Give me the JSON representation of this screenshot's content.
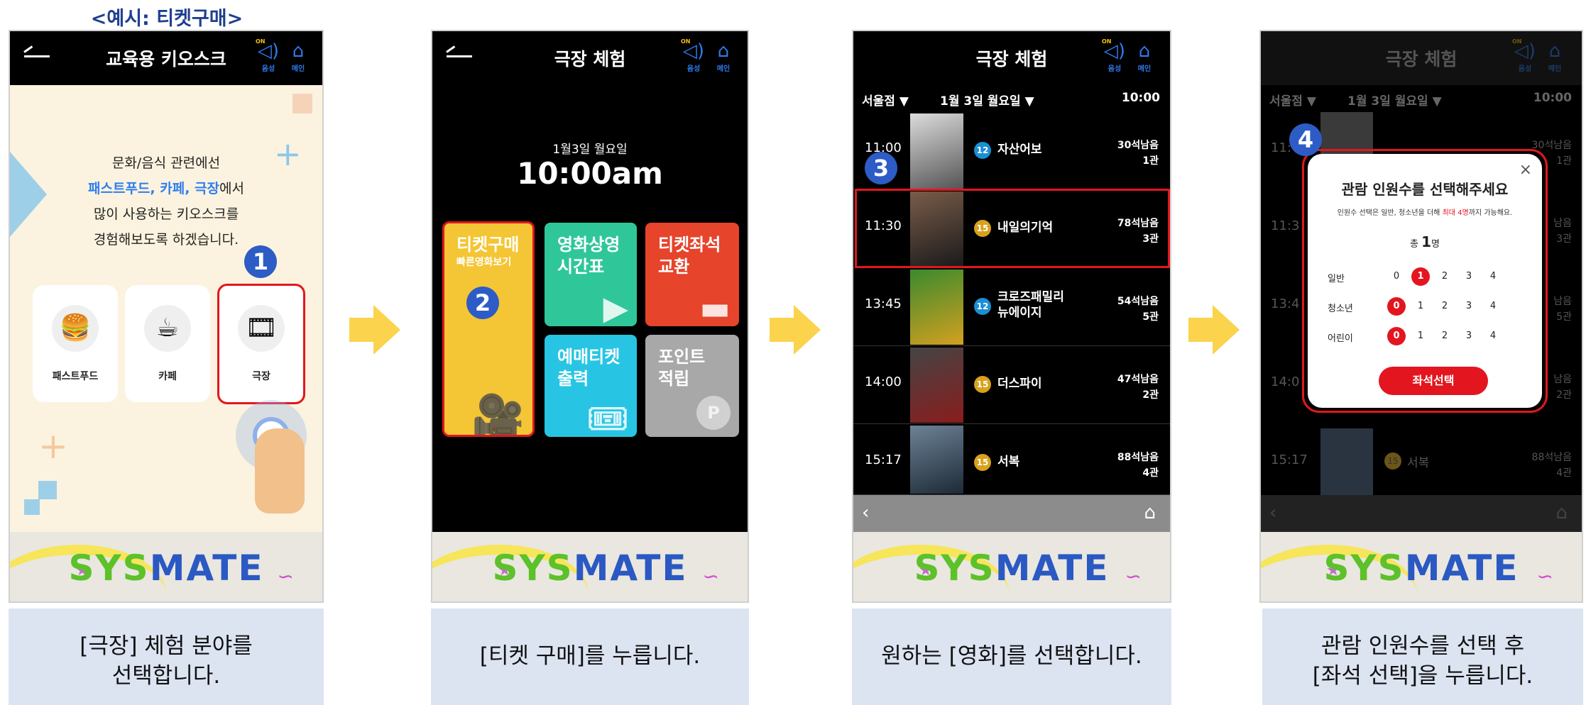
{
  "example_label": "<예시: 티켓구매>",
  "screen1": {
    "title": "교육용 키오스크",
    "sound_label": "음성",
    "sound_on": "ON",
    "main_label": "메인",
    "intro_line1": "문화/음식 관련에선",
    "intro_hl": "패스트푸드, 카페, 극장",
    "intro_line2_rest": "에서",
    "intro_line3": "많이 사용하는 키오스크를",
    "intro_line4": "경험해보도록 하겠습니다.",
    "step": "1",
    "cards": [
      "패스트푸드",
      "카페",
      "극장"
    ],
    "caption_line1": "[극장] 체험 분야를",
    "caption_line2": "선택합니다."
  },
  "screen2": {
    "title": "극장 체험",
    "sound_label": "음성",
    "sound_on": "ON",
    "main_label": "메인",
    "date": "1월3일 월요일",
    "time": "10:00am",
    "step": "2",
    "tiles": {
      "ticket_title": "티켓구매",
      "ticket_sub": "빠른영화보기",
      "schedule_line1": "영화상영",
      "schedule_line2": "시간표",
      "exchange_line1": "티켓좌석",
      "exchange_line2": "교환",
      "print_line1": "예매티켓",
      "print_line2": "출력",
      "point_line1": "포인트",
      "point_line2": "적립"
    },
    "caption": "[티켓 구매]를 누릅니다."
  },
  "screen3": {
    "title": "극장 체험",
    "sound_label": "음성",
    "sound_on": "ON",
    "main_label": "메인",
    "branch": "서울점 ▼",
    "date": "1월 3일 월요일 ▼",
    "time": "10:00",
    "step": "3",
    "movies": [
      {
        "time": "11:00",
        "age": "12",
        "name": "자산어보",
        "seats": "30석남음",
        "hall": "1관"
      },
      {
        "time": "11:30",
        "age": "15",
        "name": "내일의기억",
        "seats": "78석남음",
        "hall": "3관"
      },
      {
        "time": "13:45",
        "age": "12",
        "name": "크로즈패밀리",
        "name2": "뉴에이지",
        "seats": "54석남음",
        "hall": "5관"
      },
      {
        "time": "14:00",
        "age": "15",
        "name": "더스파이",
        "seats": "47석남음",
        "hall": "2관"
      },
      {
        "time": "15:17",
        "age": "15",
        "name": "서복",
        "seats": "88석남음",
        "hall": "4관"
      }
    ],
    "caption": "원하는 [영화]를 선택합니다."
  },
  "screen4": {
    "title": "극장 체험",
    "sound_label": "음성",
    "sound_on": "ON",
    "main_label": "메인",
    "branch": "서울점 ▼",
    "date": "1월 3일 월요일 ▼",
    "time": "10:00",
    "step": "4",
    "bg_times": [
      "11:",
      "11:3",
      "13:4",
      "14:0",
      "15:17"
    ],
    "bg_seats": [
      "30석남음",
      "남음",
      "남음",
      "남음",
      "88석남음"
    ],
    "bg_halls": [
      "1관",
      "3관",
      "5관",
      "2관",
      "4관"
    ],
    "bg_name": "서복",
    "bg_age": "15",
    "modal": {
      "title": "관람 인원수를 선택해주세요",
      "sub_pre": "인원수 선택은 일반, 청소년을 더해",
      "sub_red": "최대 4명",
      "sub_post": "까지 가능해요.",
      "total_pre": "총",
      "total_num": "1",
      "total_unit": "명",
      "rows": [
        {
          "label": "일반",
          "options": [
            "0",
            "1",
            "2",
            "3",
            "4"
          ],
          "selected": "1"
        },
        {
          "label": "청소년",
          "options": [
            "0",
            "1",
            "2",
            "3",
            "4"
          ],
          "selected": "0"
        },
        {
          "label": "어린이",
          "options": [
            "0",
            "1",
            "2",
            "3",
            "4"
          ],
          "selected": "0"
        }
      ],
      "button": "좌석선택",
      "close": "×"
    },
    "caption_line1": "관람 인원수를 선택 후",
    "caption_line2": "[좌석 선택]을 누릅니다."
  },
  "brand": {
    "part1": "SYS",
    "part2": "MATE"
  },
  "colors": {
    "accent_blue": "#2e7df0",
    "select_red": "#e3161f",
    "badge_blue": "#2e5cc6"
  }
}
